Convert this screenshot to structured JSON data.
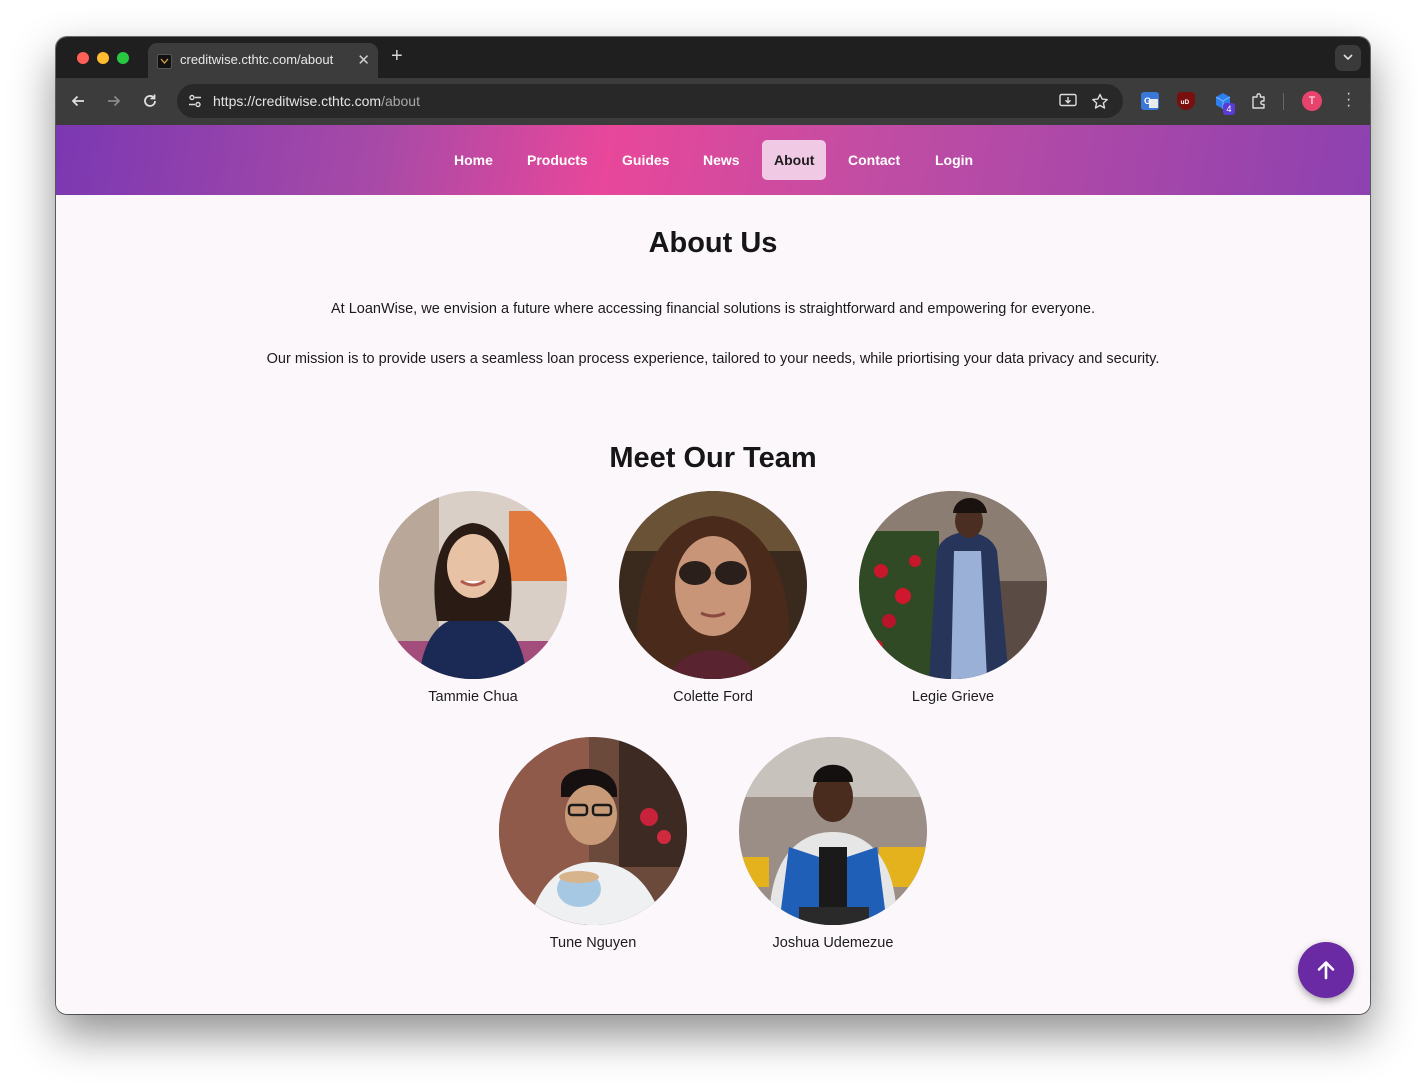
{
  "browser": {
    "tab_title": "creditwise.cthtc.com/about",
    "url_host": "https://creditwise.cthtc.com",
    "url_path": "/about",
    "profile_initial": "T",
    "extension_badge": "4"
  },
  "nav": {
    "items": [
      {
        "label": "Home"
      },
      {
        "label": "Products"
      },
      {
        "label": "Guides"
      },
      {
        "label": "News"
      },
      {
        "label": "About",
        "active": true
      },
      {
        "label": "Contact"
      },
      {
        "label": "Login"
      }
    ]
  },
  "about": {
    "title": "About Us",
    "paragraph_1": "At LoanWise, we envision a future where accessing financial solutions is straightforward and empowering for everyone.",
    "paragraph_2": "Our mission is to provide users a seamless loan process experience, tailored to your needs, while priortising your data privacy and security."
  },
  "team": {
    "title": "Meet Our Team",
    "members": [
      {
        "name": "Tammie Chua"
      },
      {
        "name": "Colette Ford"
      },
      {
        "name": "Legie Grieve"
      },
      {
        "name": "Tune Nguyen"
      },
      {
        "name": "Joshua Udemezue"
      }
    ]
  },
  "colors": {
    "nav_gradient_start": "#7b38b2",
    "nav_gradient_mid": "#e8479a",
    "active_nav_bg": "#f0c9e5",
    "page_bg": "#fcf7fb",
    "scroll_button": "#6a2aa3"
  },
  "icons": {
    "scroll_top": "arrow-up-icon",
    "back": "arrow-left-icon",
    "forward": "arrow-right-icon",
    "reload": "reload-icon",
    "bookmark": "star-icon",
    "install": "install-app-icon",
    "extensions": "puzzle-icon"
  }
}
